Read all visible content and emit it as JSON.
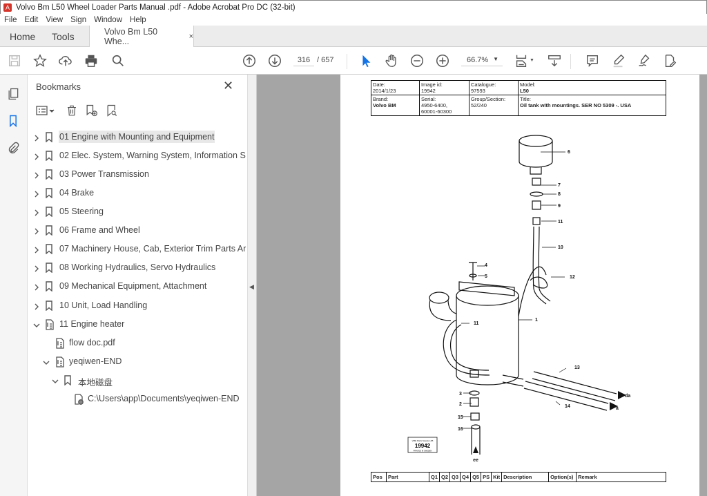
{
  "window": {
    "title": "Volvo Bm L50 Wheel Loader Parts Manual .pdf - Adobe Acrobat Pro DC (32-bit)"
  },
  "menu": [
    "File",
    "Edit",
    "View",
    "Sign",
    "Window",
    "Help"
  ],
  "tabs": {
    "home": "Home",
    "tools": "Tools",
    "document": "Volvo Bm L50 Whe...",
    "close": "×"
  },
  "toolbar": {
    "page_current": "316",
    "page_total": "/ 657",
    "zoom": "66.7%",
    "accent": "#1473e6"
  },
  "bookmarks": {
    "title": "Bookmarks",
    "items": [
      {
        "label": "01 Engine with Mounting and Equipment",
        "level": 0,
        "expand": "collapsed",
        "icon": "bookmark",
        "selected": true
      },
      {
        "label": "02 Elec. System, Warning System, Information S",
        "level": 0,
        "expand": "collapsed",
        "icon": "bookmark"
      },
      {
        "label": "03 Power Transmission",
        "level": 0,
        "expand": "collapsed",
        "icon": "bookmark"
      },
      {
        "label": "04 Brake",
        "level": 0,
        "expand": "collapsed",
        "icon": "bookmark"
      },
      {
        "label": "05 Steering",
        "level": 0,
        "expand": "collapsed",
        "icon": "bookmark"
      },
      {
        "label": "06 Frame and Wheel",
        "level": 0,
        "expand": "collapsed",
        "icon": "bookmark"
      },
      {
        "label": "07 Machinery House, Cab, Exterior Trim Parts Ar",
        "level": 0,
        "expand": "collapsed",
        "icon": "bookmark"
      },
      {
        "label": "08 Working Hydraulics, Servo Hydraulics",
        "level": 0,
        "expand": "collapsed",
        "icon": "bookmark"
      },
      {
        "label": "09 Mechanical Equipment, Attachment",
        "level": 0,
        "expand": "collapsed",
        "icon": "bookmark"
      },
      {
        "label": "10 Unit, Load Handling",
        "level": 0,
        "expand": "collapsed",
        "icon": "bookmark"
      },
      {
        "label": "11 Engine heater",
        "level": 0,
        "expand": "expanded",
        "icon": "document-bookmark"
      },
      {
        "label": "flow doc.pdf",
        "level": 1,
        "expand": "none",
        "icon": "document-bookmark"
      },
      {
        "label": "yeqiwen-END",
        "level": 1,
        "expand": "expanded",
        "icon": "document-bookmark"
      },
      {
        "label": "本地磁盘",
        "level": 2,
        "expand": "expanded",
        "icon": "bookmark"
      },
      {
        "label": "C:\\Users\\app\\Documents\\yeqiwen-END",
        "level": 3,
        "expand": "none",
        "icon": "web-link-bookmark"
      }
    ]
  },
  "document": {
    "header": {
      "date_label": "Date:",
      "date": "2014/1/23",
      "image_id_label": "Image id:",
      "image_id": "19942",
      "catalogue_label": "Catalogue:",
      "catalogue": "97593",
      "model_label": "Model:",
      "model": "L50",
      "brand_label": "Brand:",
      "brand": "Volvo BM",
      "serial_label": "Serial:",
      "serial_1": "4950-6400,",
      "serial_2": "60001-60300",
      "group_label": "Group/Section:",
      "group": "52/240",
      "title_label": "Title:",
      "title": "Oil tank with mountings. SER NO 5309 -. USA"
    },
    "diagram": {
      "callouts": [
        "6",
        "7",
        "8",
        "9",
        "11",
        "10",
        "4",
        "5",
        "12",
        "1",
        "11",
        "13",
        "da",
        "14",
        "â",
        "3",
        "2",
        "15",
        "16",
        "ee"
      ],
      "stamp_top": "VME Parts Sweden AB",
      "stamp_id": "19942",
      "stamp_bottom": "PRINTED IN SWEDEN"
    },
    "parts_table_headers": [
      "Pos",
      "Part",
      "Q1",
      "Q2",
      "Q3",
      "Q4",
      "Q5",
      "PS",
      "Kit",
      "Description",
      "Option(s)",
      "Remark"
    ]
  }
}
